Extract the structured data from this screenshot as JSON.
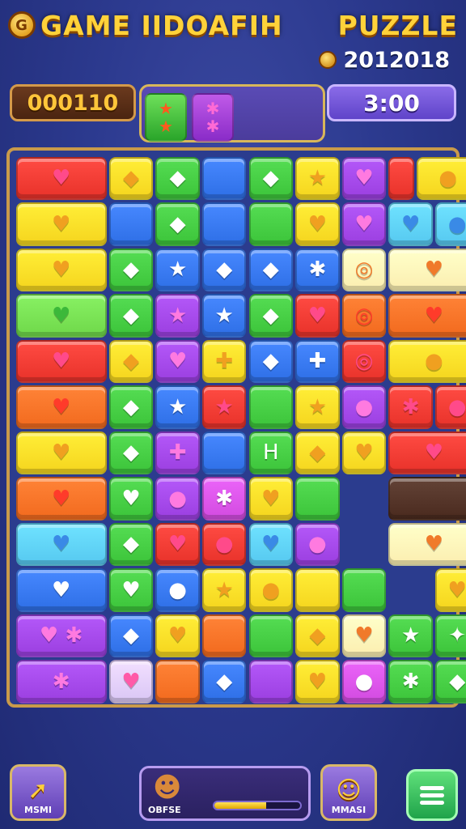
{
  "header": {
    "title_left": "GAME IIDOAFIH",
    "title_right": "PUZZLE",
    "logo_letter": "G",
    "year_text": "2012018"
  },
  "hud": {
    "score": "000110",
    "timer": "3:00",
    "preview": [
      {
        "color": "green",
        "icon": "star-icon",
        "symbol": "★"
      },
      {
        "color": "purple",
        "icon": "sparkle-icon",
        "symbol": "✱"
      }
    ]
  },
  "colors": {
    "red": "#e8322a",
    "yellow": "#f5d51e",
    "green": "#3cc43a",
    "blue": "#2e6fe6",
    "lime": "#6fd84a",
    "purple": "#9b3fe0",
    "orange": "#f26a1e",
    "cyan": "#56c9f0",
    "cream": "#fbeeb0",
    "magenta": "#d24be0",
    "brown": "#4a2a1e",
    "lavender": "#d9c6f5"
  },
  "board": {
    "rows": [
      [
        {
          "c": "red",
          "s": "♥",
          "w": 2
        },
        {
          "c": "yellow",
          "s": "◆"
        },
        {
          "c": "green",
          "s": "◆"
        },
        {
          "c": "blue",
          "s": ""
        },
        {
          "c": "green",
          "s": "◆"
        },
        {
          "c": "yellow",
          "s": "★"
        },
        {
          "c": "purple",
          "s": "♥"
        },
        {
          "c": "red",
          "s": "",
          "w": 0.6
        },
        {
          "c": "yellow",
          "s": "●",
          "w": 1.4
        }
      ],
      [
        {
          "c": "yellow",
          "s": "♥",
          "w": 2
        },
        {
          "c": "blue",
          "s": ""
        },
        {
          "c": "green",
          "s": "◆"
        },
        {
          "c": "blue",
          "s": ""
        },
        {
          "c": "green",
          "s": ""
        },
        {
          "c": "yellow",
          "s": "♥"
        },
        {
          "c": "purple",
          "s": "♥"
        },
        {
          "c": "cyan",
          "s": "♥"
        },
        {
          "c": "cyan",
          "s": "●"
        }
      ],
      [
        {
          "c": "yellow",
          "s": "♥",
          "w": 2
        },
        {
          "c": "green",
          "s": "◆"
        },
        {
          "c": "blue",
          "s": "★"
        },
        {
          "c": "blue",
          "s": "◆"
        },
        {
          "c": "blue",
          "s": "◆"
        },
        {
          "c": "blue",
          "s": "✱"
        },
        {
          "c": "cream",
          "s": "◎"
        },
        {
          "c": "cream",
          "s": "♥",
          "w": 2
        }
      ],
      [
        {
          "c": "lime",
          "s": "♥",
          "w": 2
        },
        {
          "c": "green",
          "s": "◆"
        },
        {
          "c": "purple",
          "s": "★"
        },
        {
          "c": "blue",
          "s": "★"
        },
        {
          "c": "green",
          "s": "◆"
        },
        {
          "c": "red",
          "s": "♥"
        },
        {
          "c": "orange",
          "s": "◎"
        },
        {
          "c": "orange",
          "s": "♥",
          "w": 2
        }
      ],
      [
        {
          "c": "red",
          "s": "♥",
          "w": 2
        },
        {
          "c": "yellow",
          "s": "◆"
        },
        {
          "c": "purple",
          "s": "♥"
        },
        {
          "c": "yellow",
          "s": "✚"
        },
        {
          "c": "blue",
          "s": "◆"
        },
        {
          "c": "blue",
          "s": "✚"
        },
        {
          "c": "red",
          "s": "◎"
        },
        {
          "c": "yellow",
          "s": "●",
          "w": 2
        }
      ],
      [
        {
          "c": "orange",
          "s": "♥",
          "w": 2
        },
        {
          "c": "green",
          "s": "◆"
        },
        {
          "c": "blue",
          "s": "★"
        },
        {
          "c": "red",
          "s": "★"
        },
        {
          "c": "green",
          "s": ""
        },
        {
          "c": "yellow",
          "s": "★"
        },
        {
          "c": "purple",
          "s": "●"
        },
        {
          "c": "red",
          "s": "✱"
        },
        {
          "c": "red",
          "s": "●"
        }
      ],
      [
        {
          "c": "yellow",
          "s": "♥",
          "w": 2
        },
        {
          "c": "green",
          "s": "◆"
        },
        {
          "c": "purple",
          "s": "✚"
        },
        {
          "c": "blue",
          "s": ""
        },
        {
          "c": "green",
          "s": "H"
        },
        {
          "c": "yellow",
          "s": "◆"
        },
        {
          "c": "yellow",
          "s": "♥"
        },
        {
          "c": "red",
          "s": "♥",
          "w": 2
        }
      ],
      [
        {
          "c": "orange",
          "s": "♥",
          "w": 2
        },
        {
          "c": "green",
          "s": "♥"
        },
        {
          "c": "purple",
          "s": "●"
        },
        {
          "c": "magenta",
          "s": "✱"
        },
        {
          "c": "yellow",
          "s": "♥"
        },
        {
          "c": "green",
          "s": ""
        },
        {
          "c": "empty",
          "s": ""
        },
        {
          "c": "brown",
          "s": "",
          "w": 2
        }
      ],
      [
        {
          "c": "cyan",
          "s": "♥",
          "w": 2
        },
        {
          "c": "green",
          "s": "◆"
        },
        {
          "c": "red",
          "s": "♥"
        },
        {
          "c": "red",
          "s": "●"
        },
        {
          "c": "cyan",
          "s": "♥"
        },
        {
          "c": "purple",
          "s": "●"
        },
        {
          "c": "empty",
          "s": ""
        },
        {
          "c": "cream",
          "s": "♥",
          "w": 2
        }
      ],
      [
        {
          "c": "blue",
          "s": "♥",
          "w": 2
        },
        {
          "c": "green",
          "s": "♥"
        },
        {
          "c": "blue",
          "s": "●"
        },
        {
          "c": "yellow",
          "s": "★"
        },
        {
          "c": "yellow",
          "s": "●"
        },
        {
          "c": "yellow",
          "s": ""
        },
        {
          "c": "green",
          "s": ""
        },
        {
          "c": "empty",
          "s": ""
        },
        {
          "c": "yellow",
          "s": "♥"
        }
      ],
      [
        {
          "c": "purple",
          "s": "♥ ✱",
          "w": 2
        },
        {
          "c": "blue",
          "s": "◆"
        },
        {
          "c": "yellow",
          "s": "♥"
        },
        {
          "c": "orange",
          "s": ""
        },
        {
          "c": "green",
          "s": ""
        },
        {
          "c": "yellow",
          "s": "◆"
        },
        {
          "c": "cream",
          "s": "♥"
        },
        {
          "c": "green",
          "s": "★"
        },
        {
          "c": "green",
          "s": "✦"
        }
      ],
      [
        {
          "c": "purple",
          "s": "✱",
          "w": 2
        },
        {
          "c": "lavender",
          "s": "♥"
        },
        {
          "c": "orange",
          "s": ""
        },
        {
          "c": "blue",
          "s": "◆"
        },
        {
          "c": "purple",
          "s": ""
        },
        {
          "c": "yellow",
          "s": "♥"
        },
        {
          "c": "magenta",
          "s": "●"
        },
        {
          "c": "green",
          "s": "✱"
        },
        {
          "c": "green",
          "s": "◆"
        }
      ]
    ]
  },
  "footer": {
    "left_label": "MSMI",
    "mid_label": "OBFSE",
    "right_label": "MMASI",
    "progress_fraction": 0.6
  }
}
